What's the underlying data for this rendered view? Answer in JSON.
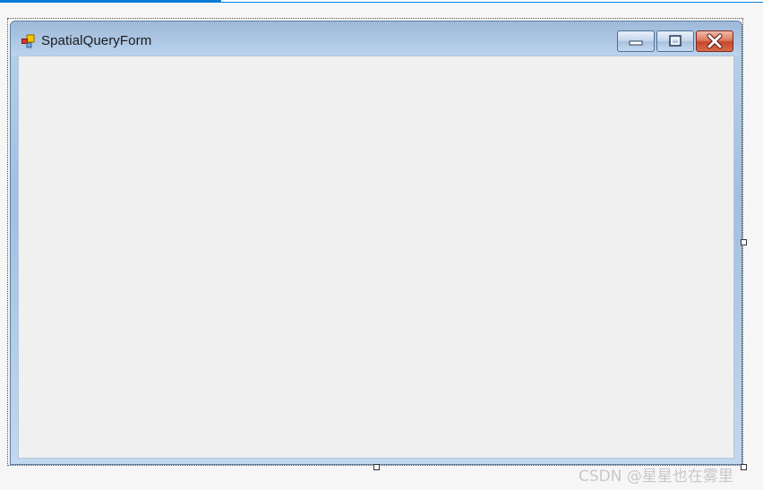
{
  "form": {
    "title": "SpatialQueryForm",
    "icon": "winforms-app-icon",
    "controls": {
      "minimize": "minimize-icon",
      "maximize": "maximize-icon",
      "close": "close-icon"
    }
  },
  "watermark": "CSDN @星星也在雾里",
  "colors": {
    "accent": "#0a7bd6",
    "client_area": "#f0f0f0",
    "close_button": "#c8472b"
  }
}
